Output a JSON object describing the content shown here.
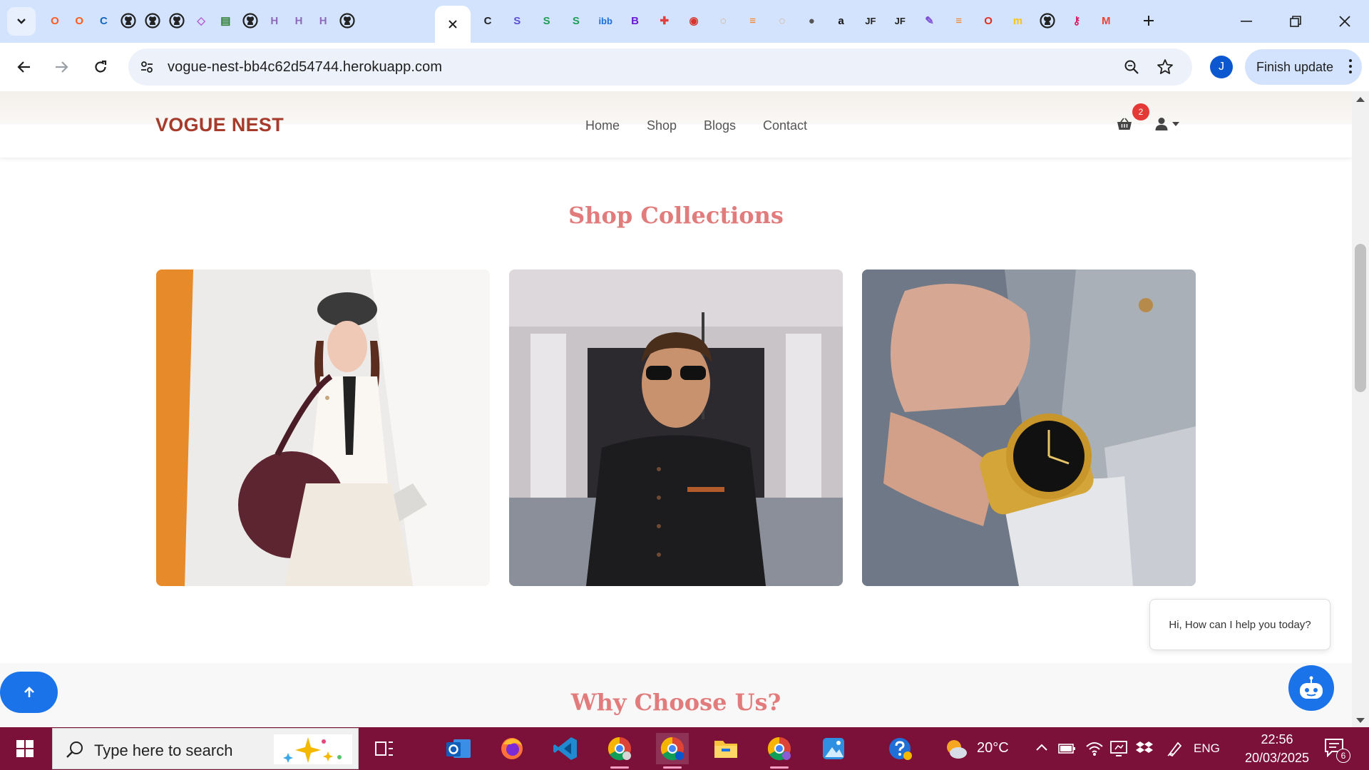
{
  "browser": {
    "tabs": [
      {
        "name": "opera-tab",
        "glyph": "O",
        "color": "#ff5a1f"
      },
      {
        "name": "opera-tab-2",
        "glyph": "O",
        "color": "#ff5a1f"
      },
      {
        "name": "chromium-tab",
        "glyph": "C",
        "color": "#1565c0"
      },
      {
        "name": "github-tab-1",
        "glyph": "",
        "color": "#222222"
      },
      {
        "name": "github-tab-2",
        "glyph": "",
        "color": "#222222"
      },
      {
        "name": "github-tab-3",
        "glyph": "",
        "color": "#222222"
      },
      {
        "name": "cube-tab",
        "glyph": "◇",
        "color": "#b45cd6"
      },
      {
        "name": "sheet-tab",
        "glyph": "▤",
        "color": "#2e7d32"
      },
      {
        "name": "github-tab-4",
        "glyph": "",
        "color": "#222222"
      },
      {
        "name": "heroku-tab-1",
        "glyph": "H",
        "color": "#8e6bb8"
      },
      {
        "name": "heroku-tab-2",
        "glyph": "H",
        "color": "#8e6bb8"
      },
      {
        "name": "heroku-tab-3",
        "glyph": "H",
        "color": "#8e6bb8"
      },
      {
        "name": "github-tab-5",
        "glyph": "",
        "color": "#222222"
      }
    ],
    "tabs_after": [
      {
        "name": "c-tab",
        "glyph": "C",
        "color": "#222222"
      },
      {
        "name": "s-tab-1",
        "glyph": "S",
        "color": "#5b4fd6"
      },
      {
        "name": "s-tab-2",
        "glyph": "S",
        "color": "#1e9e54"
      },
      {
        "name": "s-tab-3",
        "glyph": "S",
        "color": "#1e9e54"
      },
      {
        "name": "ibb-tab",
        "glyph": "ibb",
        "color": "#1f6ed4"
      },
      {
        "name": "b-tab",
        "glyph": "B",
        "color": "#6a1bd1"
      },
      {
        "name": "puzzle-tab",
        "glyph": "✚",
        "color": "#e0403a"
      },
      {
        "name": "record-tab",
        "glyph": "◉",
        "color": "#d8342b"
      },
      {
        "name": "swirl-tab-1",
        "glyph": "◌",
        "color": "#d68a3a"
      },
      {
        "name": "stack-tab-1",
        "glyph": "≡",
        "color": "#f48024"
      },
      {
        "name": "swirl-tab-2",
        "glyph": "◌",
        "color": "#d68a3a"
      },
      {
        "name": "globe-tab",
        "glyph": "●",
        "color": "#555555"
      },
      {
        "name": "amazon-tab",
        "glyph": "a",
        "color": "#111111"
      },
      {
        "name": "jf-tab-1",
        "glyph": "JF",
        "color": "#222222"
      },
      {
        "name": "jf-tab-2",
        "glyph": "JF",
        "color": "#222222"
      },
      {
        "name": "pen-tab",
        "glyph": "✎",
        "color": "#7b4bd6"
      },
      {
        "name": "stack-tab-2",
        "glyph": "≡",
        "color": "#f48024"
      },
      {
        "name": "opera-tab-3",
        "glyph": "O",
        "color": "#e0301e"
      },
      {
        "name": "miro-tab",
        "glyph": "m",
        "color": "#f5c518"
      },
      {
        "name": "github-tab-6",
        "glyph": "",
        "color": "#222222"
      },
      {
        "name": "key-tab",
        "glyph": "⚷",
        "color": "#d81b60"
      },
      {
        "name": "gmail-tab",
        "glyph": "M",
        "color": "#ea4335"
      }
    ],
    "url": "vogue-nest-bb4c62d54744.herokuapp.com",
    "profile_initial": "J",
    "finish_update_label": "Finish update"
  },
  "site": {
    "brand": "VOGUE NEST",
    "nav": [
      "Home",
      "Shop",
      "Blogs",
      "Contact"
    ],
    "cart_count": "2",
    "collections_title": "Shop Collections",
    "why_title": "Why Choose Us?",
    "chat_message": "Hi, How can I help you today?"
  },
  "taskbar": {
    "search_placeholder": "Type here to search",
    "weather_temp": "20°C",
    "language": "ENG",
    "time": "22:56",
    "date": "20/03/2025",
    "notification_count": "6"
  }
}
